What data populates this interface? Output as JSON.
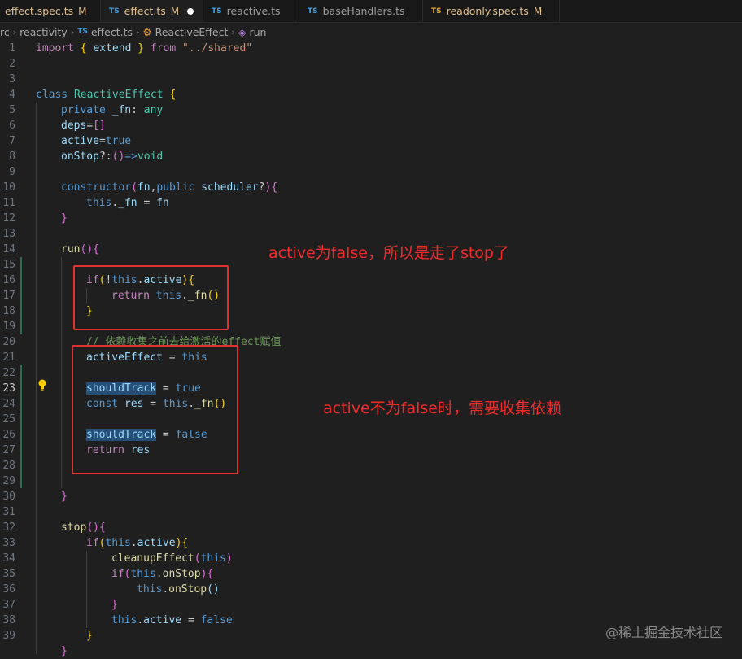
{
  "tabs": [
    {
      "name": "effect.spec.ts",
      "status": "M"
    },
    {
      "name": "effect.ts",
      "status": "M"
    },
    {
      "name": "reactive.ts"
    },
    {
      "name": "baseHandlers.ts"
    },
    {
      "name": "readonly.spec.ts",
      "status": "M"
    }
  ],
  "breadcrumb": {
    "root": "rc",
    "folder": "reactivity",
    "file_badge": "TS",
    "file": "effect.ts",
    "class": "ReactiveEffect",
    "method": "run"
  },
  "line_numbers": [
    "1",
    "2",
    "3",
    "4",
    "5",
    "6",
    "7",
    "8",
    "9",
    "10",
    "11",
    "12",
    "13",
    "14",
    "15",
    "16",
    "17",
    "18",
    "19",
    "20",
    "21",
    "22",
    "23",
    "24",
    "25",
    "26",
    "27",
    "28",
    "29",
    "30",
    "31",
    "32",
    "33",
    "34",
    "35",
    "36",
    "37",
    "38",
    "39"
  ],
  "code": {
    "l1": [
      "import",
      "{",
      "extend",
      "}",
      "from",
      "\"../shared\""
    ],
    "l4": [
      "class",
      "ReactiveEffect",
      "{"
    ],
    "l5": [
      "private",
      "_fn",
      ":",
      "any"
    ],
    "l6": [
      "deps",
      "=",
      "[]"
    ],
    "l7": [
      "active",
      "=",
      "true"
    ],
    "l8": [
      "onStop",
      "?:",
      "()",
      "=>",
      "void"
    ],
    "l10": [
      "constructor",
      "(",
      "fn",
      ",",
      "public",
      "scheduler",
      "?",
      ")",
      "{"
    ],
    "l11": [
      "this",
      ".",
      "_fn",
      "=",
      "fn"
    ],
    "l12": [
      "}"
    ],
    "l14": [
      "run",
      "(){"
    ],
    "l16": [
      "if",
      "(",
      "!",
      "this",
      ".",
      "active",
      "){"
    ],
    "l17": [
      "return",
      "this",
      ".",
      "_fn",
      "()"
    ],
    "l18": [
      "}"
    ],
    "l20": "// 依赖收集之前去给激活的effect赋值",
    "l21": [
      "activeEffect",
      "=",
      "this"
    ],
    "l23": [
      "shouldTrack",
      "=",
      "true"
    ],
    "l24": [
      "const",
      "res",
      "=",
      "this",
      ".",
      "_fn",
      "()"
    ],
    "l26": [
      "shouldTrack",
      "=",
      "false"
    ],
    "l27": [
      "return",
      "res"
    ],
    "l30": [
      "}"
    ],
    "l32": [
      "stop",
      "(){"
    ],
    "l33": [
      "if",
      "(",
      "this",
      ".",
      "active",
      "){"
    ],
    "l34": [
      "cleanupEffect",
      "(",
      "this",
      ")"
    ],
    "l35": [
      "if",
      "(",
      "this",
      ".",
      "onStop",
      "){"
    ],
    "l36": [
      "this",
      ".",
      "onStop",
      "()"
    ],
    "l37": [
      "}"
    ],
    "l38": [
      "this",
      ".",
      "active",
      "=",
      "false"
    ],
    "l39": [
      "}"
    ],
    "l40": [
      "}"
    ]
  },
  "annotations": {
    "top": "active为false，所以是走了stop了",
    "bottom": "active不为false时，需要收集依赖"
  },
  "watermark": "@稀土掘金技术社区",
  "colors": {
    "keyword": "#569cd6",
    "control": "#c586c0",
    "type": "#4ec9b0",
    "function": "#dcdcaa",
    "variable": "#9cdcfe",
    "string": "#ce9178",
    "comment": "#6a9955",
    "annotation_red": "#f02b2b"
  }
}
